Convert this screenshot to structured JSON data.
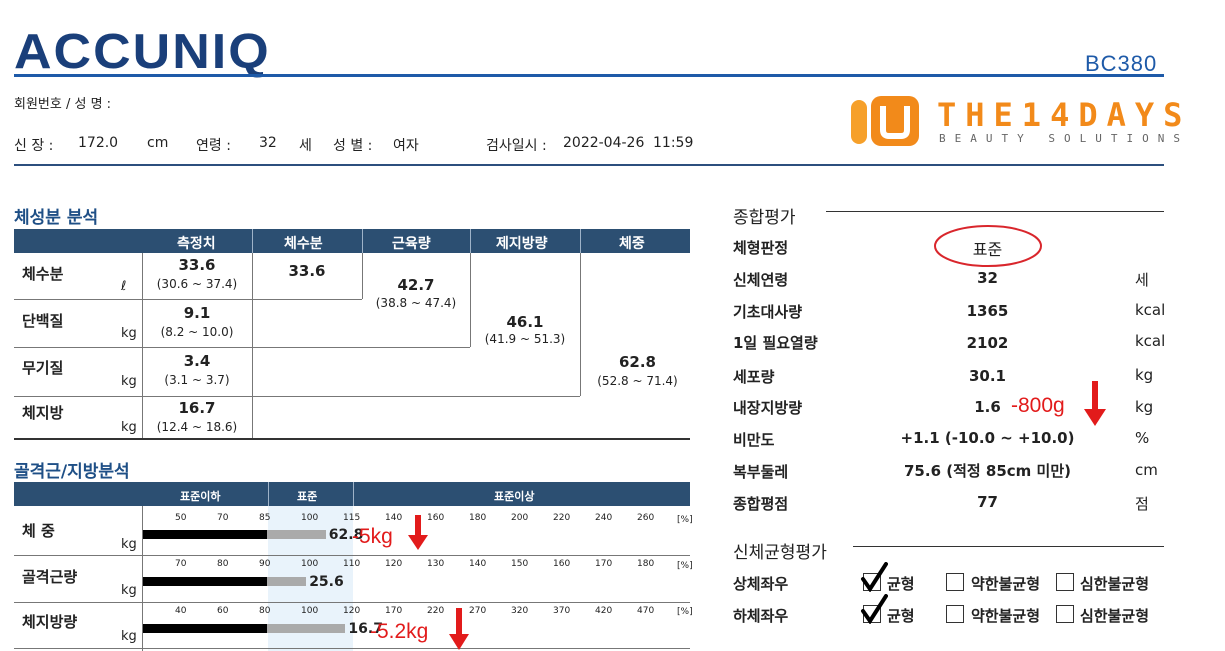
{
  "brand": {
    "logo": "ACCUNIQ",
    "model": "BC380",
    "partner_name": "THE14DAYS",
    "partner_sub": "BEAUTY SOLUTIONS",
    "accent": "#1e5aa8"
  },
  "header": {
    "member_label": "회원번호 / 성 명 :",
    "height_label": "신 장 :",
    "height": "172.0",
    "height_unit": "cm",
    "age_label": "연령 :",
    "age": "32",
    "age_unit": "세",
    "sex_label": "성 별 :",
    "sex": "여자",
    "date_label": "검사일시 :",
    "date": "2022-04-26",
    "time": "11:59"
  },
  "body_comp": {
    "title": "체성분 분석",
    "headers": [
      "측정치",
      "체수분",
      "근육량",
      "제지방량",
      "체중"
    ],
    "rows": [
      {
        "label": "체수분",
        "unit": "ℓ",
        "value": "33.6",
        "range": "(30.6 ~ 37.4)"
      },
      {
        "label": "단백질",
        "unit": "kg",
        "value": "9.1",
        "range": "(8.2 ~ 10.0)"
      },
      {
        "label": "무기질",
        "unit": "kg",
        "value": "3.4",
        "range": "(3.1 ~ 3.7)"
      },
      {
        "label": "체지방",
        "unit": "kg",
        "value": "16.7",
        "range": "(12.4 ~ 18.6)"
      }
    ],
    "water": "33.6",
    "muscle": {
      "value": "42.7",
      "range": "(38.8 ~ 47.4)"
    },
    "ffm": {
      "value": "46.1",
      "range": "(41.9 ~ 51.3)"
    },
    "weight": {
      "value": "62.8",
      "range": "(52.8 ~ 71.4)"
    }
  },
  "muscle_fat": {
    "title": "골격근/지방분석",
    "headers": [
      "표준이하",
      "표준",
      "표준이상"
    ],
    "rows": [
      {
        "label": "체 중",
        "unit": "kg",
        "ticks": [
          "50",
          "70",
          "85",
          "100",
          "115",
          "140",
          "160",
          "180",
          "200",
          "220",
          "240",
          "260"
        ],
        "value": "62.8",
        "level_pct": 106,
        "note": "-5kg"
      },
      {
        "label": "골격근량",
        "unit": "kg",
        "ticks": [
          "70",
          "80",
          "90",
          "100",
          "110",
          "120",
          "130",
          "140",
          "150",
          "160",
          "170",
          "180"
        ],
        "value": "25.6",
        "level_pct": 99
      },
      {
        "label": "체지방량",
        "unit": "kg",
        "ticks": [
          "40",
          "60",
          "80",
          "100",
          "120",
          "170",
          "220",
          "270",
          "320",
          "370",
          "420",
          "470"
        ],
        "value": "16.7",
        "level_pct": 113,
        "note": "-5.2kg"
      }
    ],
    "pct_label": "[%]"
  },
  "summary": {
    "title": "종합평가",
    "rows": [
      {
        "label": "체형판정",
        "value": "표준",
        "unit": ""
      },
      {
        "label": "신체연령",
        "value": "32",
        "unit": "세"
      },
      {
        "label": "기초대사량",
        "value": "1365",
        "unit": "kcal"
      },
      {
        "label": "1일 필요열량",
        "value": "2102",
        "unit": "kcal"
      },
      {
        "label": "세포량",
        "value": "30.1",
        "unit": "kg"
      },
      {
        "label": "내장지방량",
        "value": "1.6",
        "unit": "kg"
      },
      {
        "label": "비만도",
        "value": "+1.1 (-10.0 ~ +10.0)",
        "unit": "%"
      },
      {
        "label": "복부둘레",
        "value": "75.6 (적정 85cm 미만)",
        "unit": "cm"
      },
      {
        "label": "종합평점",
        "value": "77",
        "unit": "점"
      }
    ],
    "visceral_note": "-800g"
  },
  "balance": {
    "title": "신체균형평가",
    "options": [
      "균형",
      "약한불균형",
      "심한불균형"
    ],
    "rows": [
      {
        "label": "상체좌우",
        "checked": "균형"
      },
      {
        "label": "하체좌우",
        "checked": "균형"
      }
    ]
  }
}
